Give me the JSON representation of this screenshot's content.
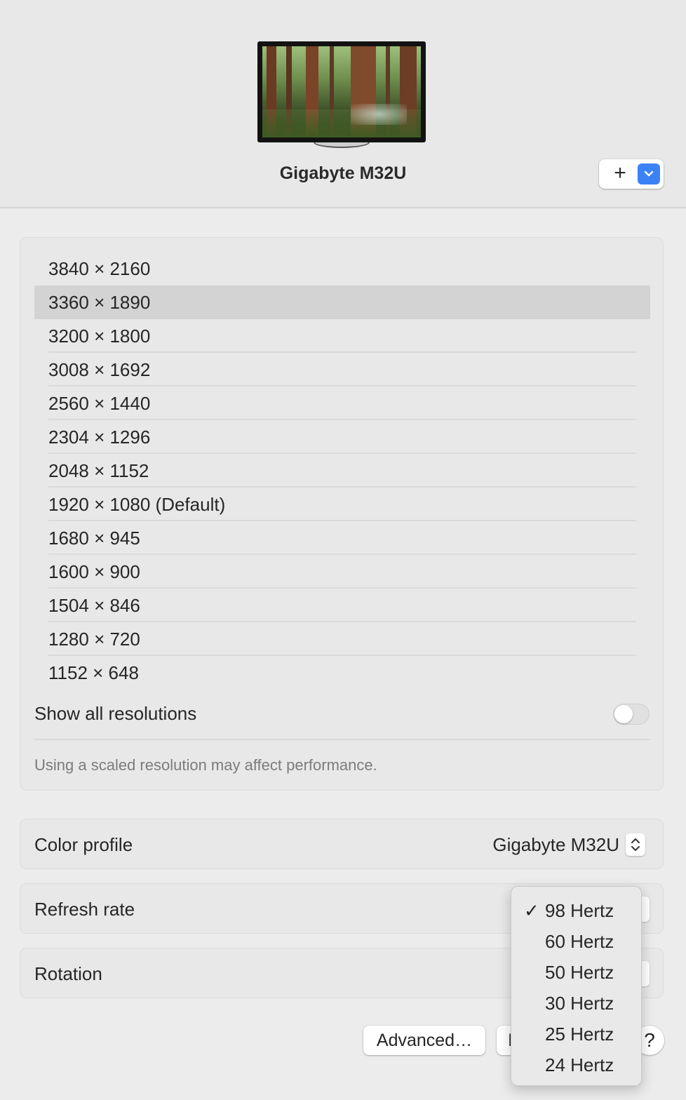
{
  "display": {
    "name": "Gigabyte M32U"
  },
  "header": {
    "add_label": "+"
  },
  "resolutions": {
    "items": [
      "3840 × 2160",
      "3360 × 1890",
      "3200 × 1800",
      "3008 × 1692",
      "2560 × 1440",
      "2304 × 1296",
      "2048 × 1152",
      "1920 × 1080 (Default)",
      "1680 × 945",
      "1600 × 900",
      "1504 × 846",
      "1280 × 720",
      "1152 × 648"
    ],
    "selected": "3360 × 1890",
    "show_all_label": "Show all resolutions",
    "show_all_enabled": false,
    "note": "Using a scaled resolution may affect performance."
  },
  "color_profile": {
    "label": "Color profile",
    "value": "Gigabyte M32U"
  },
  "refresh_rate": {
    "label": "Refresh rate",
    "options": [
      "98 Hertz",
      "60 Hertz",
      "50 Hertz",
      "30 Hertz",
      "25 Hertz",
      "24 Hertz"
    ],
    "selected": "98 Hertz",
    "check_glyph": "✓"
  },
  "rotation": {
    "label": "Rotation"
  },
  "footer": {
    "advanced_label": "Advanced…",
    "second_button_label": "I",
    "help_label": "?"
  },
  "colors": {
    "accent": "#3b82f6",
    "selected_row": "#d3d3d3",
    "background": "#ececec"
  }
}
